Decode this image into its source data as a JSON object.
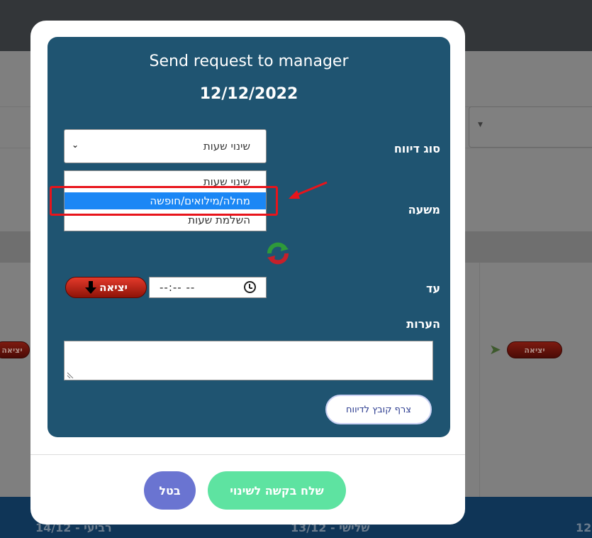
{
  "background": {
    "exit_badge_label": "יציאה",
    "days": [
      {
        "label": "רביעי - 14/12"
      },
      {
        "label": "שלישי - 13/12"
      },
      {
        "label": "12"
      }
    ]
  },
  "modal": {
    "title": "Send request to manager",
    "date": "12/12/2022",
    "fields": {
      "report_type_label": "סוג דיווח",
      "shift_label": "משעה",
      "until_label": "עד",
      "notes_label": "הערות"
    },
    "report_type_select": {
      "selected": "שינוי שעות",
      "options": [
        {
          "label": "שינוי שעות",
          "highlighted": false
        },
        {
          "label": "מחלה/מילואים/חופשה",
          "highlighted": true
        },
        {
          "label": "השלמת שעות",
          "highlighted": false
        }
      ]
    },
    "time_input": {
      "value": "--:-- --"
    },
    "exit_button_label": "יציאה",
    "notes_value": "",
    "attach_button_label": "צרף קובץ לדיווח",
    "send_button_label": "שלח בקשה לשינוי",
    "cancel_button_label": "בטל"
  },
  "colors": {
    "panel": "#1f5471",
    "selected_option": "#1b87f5",
    "highlight_box": "#e8141b",
    "send_button": "#5ee3a1",
    "cancel_button": "#6a74d1"
  }
}
